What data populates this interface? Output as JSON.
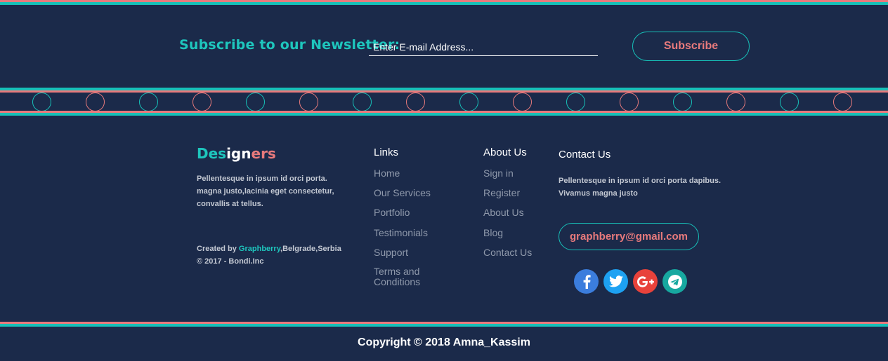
{
  "colors": {
    "background": "#1b2a4a",
    "teal": "#17c0b8",
    "pink": "#e87a7c",
    "muted_text": "#8f99ab",
    "body_text": "#c3c8d2"
  },
  "newsletter": {
    "title": "Subscribe to our Newsletter:",
    "email_placeholder": "Enter E-mail Address...",
    "button_label": "Subscribe"
  },
  "brand": {
    "name_part1": "Des",
    "name_part2": "ign",
    "name_part3": "ers",
    "description": "Pellentesque in ipsum id orci porta. magna justo,lacinia eget consectetur, convallis at tellus.",
    "credit_prefix": "Created by ",
    "credit_link": "Graphberry",
    "credit_suffix": ",Belgrade,Serbia",
    "credit_line2": "© 2017 - Bondi.Inc"
  },
  "links": {
    "title": "Links",
    "items": [
      "Home",
      "Our Services",
      "Portfolio",
      "Testimonials",
      "Support",
      "Terms and Conditions"
    ]
  },
  "about": {
    "title": "About Us",
    "items": [
      "Sign in",
      "Register",
      "About Us",
      "Blog",
      "Contact Us"
    ]
  },
  "contact": {
    "title": "Contact Us",
    "text": "Pellentesque in ipsum id orci porta dapibus. Vivamus magna justo",
    "email": "graphberry@gmail.com",
    "social": [
      {
        "icon": "facebook-icon",
        "color": "#3b7ddd"
      },
      {
        "icon": "twitter-icon",
        "color": "#1da1f2"
      },
      {
        "icon": "google-plus-icon",
        "color": "#e8423b"
      },
      {
        "icon": "telegram-icon",
        "color": "#17a8a0"
      }
    ]
  },
  "footer": {
    "copyright": "Copyright © 2018 Amna_Kassim"
  }
}
